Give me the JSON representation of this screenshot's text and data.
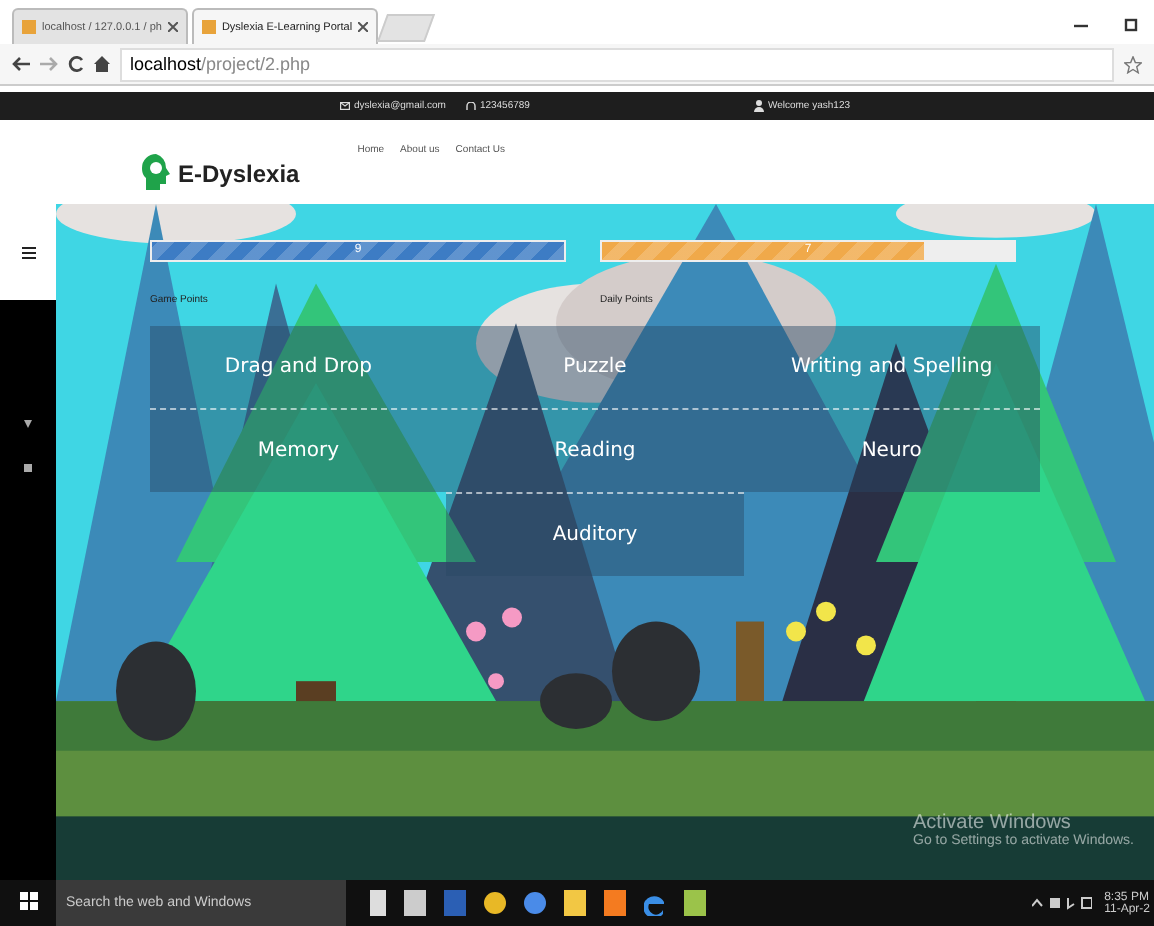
{
  "browser": {
    "tabs": [
      {
        "title": "localhost / 127.0.0.1 / ph",
        "selected": false
      },
      {
        "title": "Dyslexia E-Learning Portal",
        "selected": true
      }
    ],
    "url_host": "localhost",
    "url_path": "/project/2.php"
  },
  "top_bar": {
    "email": "dyslexia@gmail.com",
    "phone": "123456789",
    "welcome": "Welcome yash123"
  },
  "header": {
    "logo": "E-Dyslexia",
    "nav": [
      "Home",
      "About us",
      "Contact Us"
    ]
  },
  "points": [
    {
      "label": "Game Points",
      "value": "9",
      "level": 1,
      "color": "#3d7cc4"
    },
    {
      "label": "Daily Points",
      "value": "7",
      "level": 0.78,
      "color": "#f0a94a"
    }
  ],
  "games": [
    [
      "Drag and Drop",
      "Puzzle",
      "Writing and Spelling"
    ],
    [
      "Memory",
      "Reading",
      "Neuro"
    ],
    [
      "Auditory"
    ]
  ],
  "activation": {
    "title": "Activate Windows",
    "text": "Go to Settings to activate Windows."
  },
  "taskbar": {
    "search_placeholder": "Search the web and Windows",
    "time": "8:35 PM",
    "date": "11-Apr-2"
  }
}
